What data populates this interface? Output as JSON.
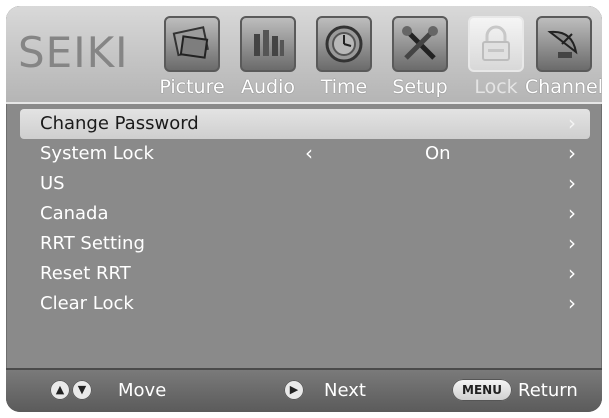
{
  "brand": "SEIKI",
  "tabs": [
    {
      "label": "Picture",
      "icon": "picture-icon"
    },
    {
      "label": "Audio",
      "icon": "audio-icon"
    },
    {
      "label": "Time",
      "icon": "clock-icon"
    },
    {
      "label": "Setup",
      "icon": "tools-icon"
    },
    {
      "label": "Lock",
      "icon": "lock-icon"
    },
    {
      "label": "Channel",
      "icon": "satellite-icon"
    }
  ],
  "menu": {
    "items": [
      {
        "label": "Change Password"
      },
      {
        "label": "System Lock",
        "value": "On"
      },
      {
        "label": "US"
      },
      {
        "label": "Canada"
      },
      {
        "label": "RRT Setting"
      },
      {
        "label": "Reset RRT"
      },
      {
        "label": "Clear Lock"
      }
    ],
    "arrow": "›",
    "left_arrow": "‹"
  },
  "footer": {
    "move": "Move",
    "next": "Next",
    "menu_button": "MENU",
    "return": "Return"
  }
}
